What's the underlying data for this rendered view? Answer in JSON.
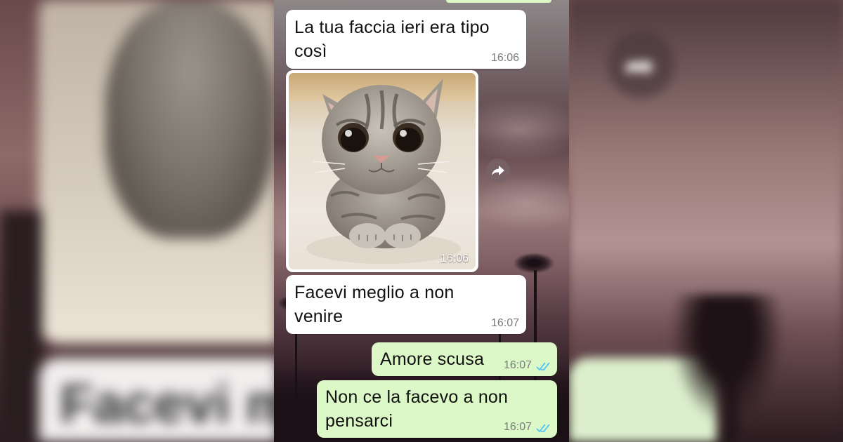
{
  "background": {
    "blurred_text": "Facevi m"
  },
  "chat": {
    "messages": [
      {
        "direction": "in",
        "text": "La tua faccia ieri era tipo così",
        "time": "16:06"
      },
      {
        "direction": "in",
        "type": "image",
        "image_subject": "sad-looking kitten",
        "time": "16:06"
      },
      {
        "direction": "in",
        "text": "Facevi meglio a non venire",
        "time": "16:07"
      },
      {
        "direction": "out",
        "text": "Amore scusa",
        "time": "16:07",
        "status": "read"
      },
      {
        "direction": "out",
        "text": "Non ce la facevo a non pensarci",
        "time": "16:07",
        "status": "read"
      }
    ]
  },
  "icons": {
    "forward": "forward-arrow-icon",
    "read_ticks": "double-check-icon"
  },
  "colors": {
    "incoming_bubble": "#ffffff",
    "outgoing_bubble": "#dcf8c6",
    "read_tick": "#4fc3f7",
    "timestamp": "#7a7a7a"
  }
}
